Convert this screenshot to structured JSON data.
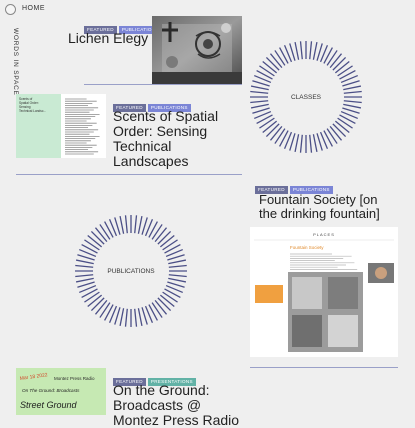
{
  "nav": {
    "home_label": "HOME",
    "brand_vertical": "WORDS IN SPACE"
  },
  "cards": {
    "lichen": {
      "tags": [
        "FEATURED",
        "PUBLICATIONS"
      ],
      "title": "Lichen Elegy"
    },
    "classes": {
      "label": "CLASSES"
    },
    "scents": {
      "tags": [
        "FEATURED",
        "PUBLICATIONS"
      ],
      "title_lines": [
        "Scents of Spatial",
        "Order: Sensing",
        "Technical",
        "Landscapes"
      ],
      "thumb_text": [
        "Scents of",
        "Spatial Order:",
        "Sensing",
        "Technical Landsc..."
      ]
    },
    "fountain": {
      "tags": [
        "FEATURED",
        "PUBLICATIONS"
      ],
      "title_lines": [
        "Fountain Society [on",
        "the drinking fountain]"
      ],
      "thumb_header": "PLACES",
      "thumb_heading": "Fountain Society"
    },
    "publications": {
      "label": "PUBLICATIONS"
    },
    "ground": {
      "tags": [
        "FEATURED",
        "PRESENTATIONS"
      ],
      "title_lines": [
        "On the Ground:",
        "Broadcasts @",
        "Montez Press Radio"
      ],
      "thumb_lines": [
        "Mar 18 2022",
        "Montez Press Radio",
        "On The Ground: Broadcasts",
        "Street Ground"
      ]
    }
  },
  "colors": {
    "background": "#efefef",
    "accent_lines": "#4b4f86",
    "tag_featured": "#6b6f9a",
    "tag_publications": "#7b85d6",
    "tag_presentations": "#62b2a6"
  }
}
